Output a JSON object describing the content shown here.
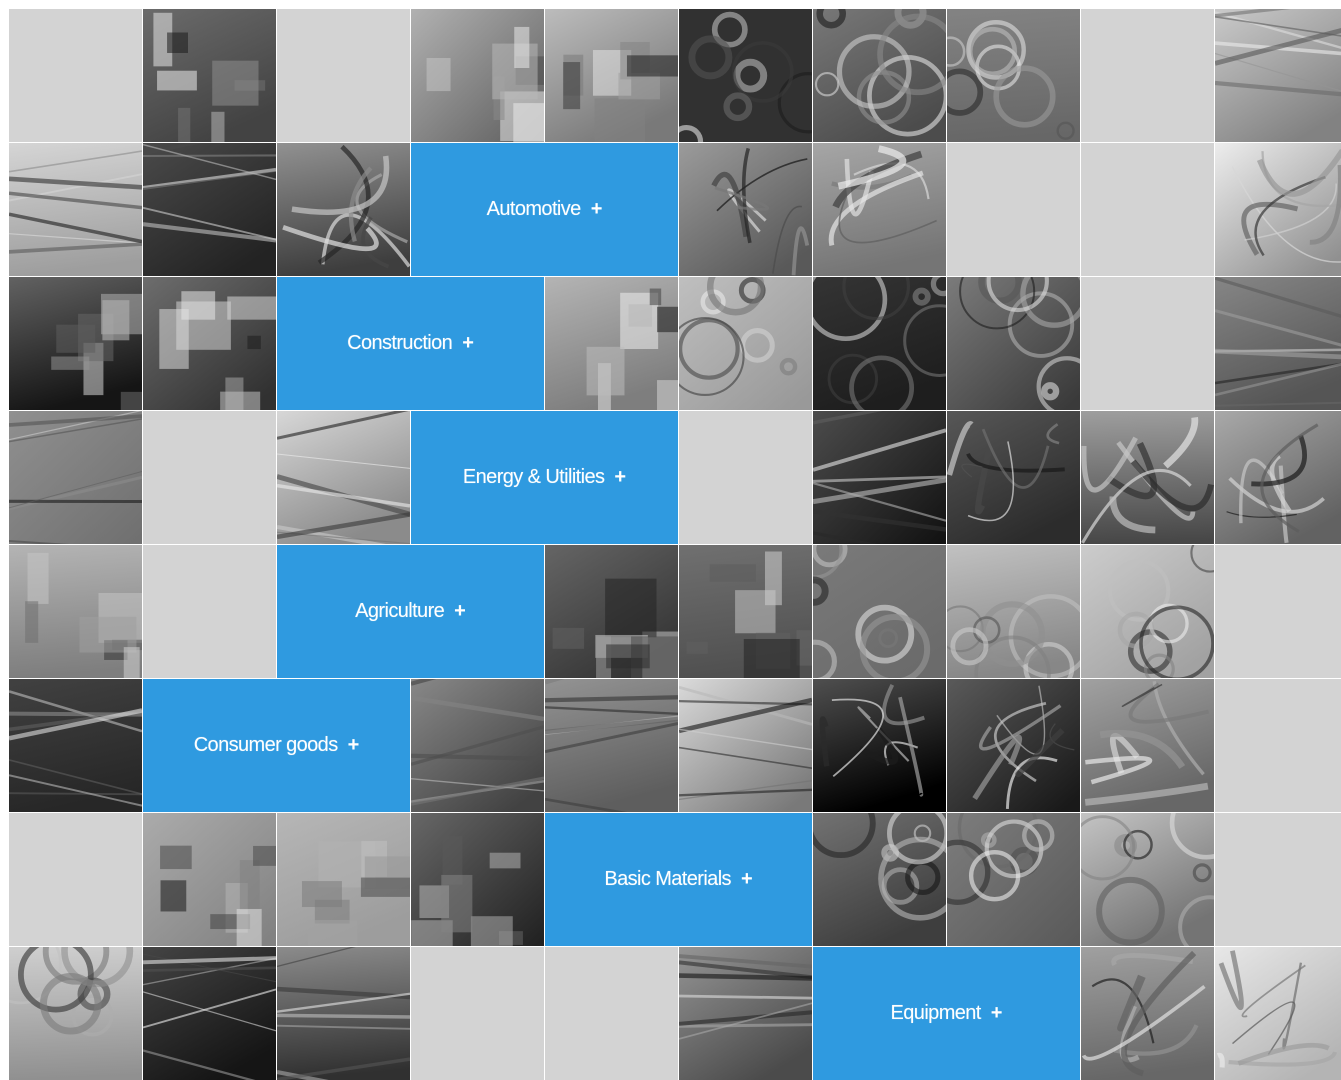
{
  "colors": {
    "category_blue": "#2f9ae0",
    "empty_tile": "#d3d3d3",
    "divider": "#ffffff"
  },
  "categories": [
    {
      "label": "Automotive",
      "icon": "plus-icon",
      "plus": "+"
    },
    {
      "label": "Construction",
      "icon": "plus-icon",
      "plus": "+"
    },
    {
      "label": "Energy & Utilities",
      "icon": "plus-icon",
      "plus": "+"
    },
    {
      "label": "Agriculture",
      "icon": "plus-icon",
      "plus": "+"
    },
    {
      "label": "Consumer goods",
      "icon": "plus-icon",
      "plus": "+"
    },
    {
      "label": "Basic Materials",
      "icon": "plus-icon",
      "plus": "+"
    },
    {
      "label": "Equipment",
      "icon": "plus-icon",
      "plus": "+"
    }
  ],
  "rows": [
    [
      "E",
      "P1",
      "E",
      "P2",
      "P3",
      "P4",
      "P5",
      "P6",
      "E",
      "P7"
    ],
    [
      "P8",
      "P9",
      "P10",
      "C0",
      "C0",
      "P11",
      "P12",
      "E",
      "E",
      "P13"
    ],
    [
      "P14",
      "P15",
      "C1",
      "C1",
      "P16",
      "P17",
      "P18",
      "P19",
      "E",
      "P20"
    ],
    [
      "P21",
      "E",
      "P22",
      "C2",
      "C2",
      "E",
      "P23",
      "P24",
      "P25",
      "P26"
    ],
    [
      "P27",
      "E",
      "C3",
      "C3",
      "P28",
      "P29",
      "P30",
      "P31",
      "P32",
      "E"
    ],
    [
      "P33",
      "C4",
      "C4",
      "P34",
      "P35",
      "P36",
      "P37",
      "P38",
      "P39",
      "E"
    ],
    [
      "E",
      "P40",
      "P41",
      "P42",
      "C5",
      "C5",
      "P43",
      "P44",
      "P45",
      "E"
    ],
    [
      "P46",
      "P47",
      "P48",
      "E",
      "E",
      "P49",
      "C6",
      "C6",
      "P50",
      "P51"
    ]
  ]
}
